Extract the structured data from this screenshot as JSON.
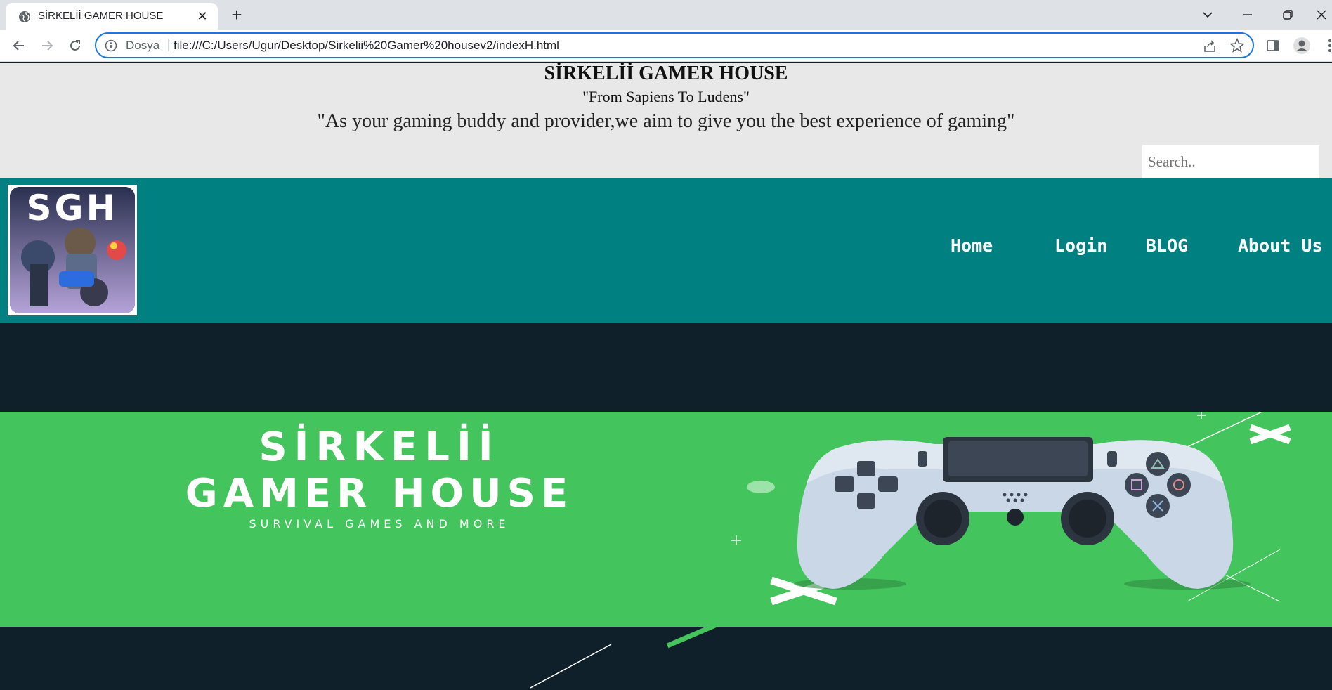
{
  "browser": {
    "tab_title": "SİRKELİİ GAMER HOUSE",
    "new_tab": "+",
    "close_tab": "✕",
    "scheme_label": "Dosya",
    "url": "file:///C:/Users/Ugur/Desktop/Sirkelii%20Gamer%20housev2/indexH.html",
    "accent": "#1a73e8"
  },
  "header": {
    "title": "SİRKELİİ GAMER HOUSE",
    "motto": "\"From Sapiens To Ludens\"",
    "mission": "\"As your gaming buddy and provider,we aim to give you the best experience of gaming\"",
    "search_placeholder": "Search.."
  },
  "navbar": {
    "logo_text": "SGH",
    "background": "#008080",
    "links": [
      {
        "label": "Home"
      },
      {
        "label": "Login"
      },
      {
        "label": "BLOG"
      },
      {
        "label": "About Us"
      }
    ]
  },
  "hero": {
    "line1": "SİRKELİİ",
    "line2": "GAMER HOUSE",
    "tagline": "SURVIVAL GAMES AND MORE",
    "banner_color": "#44c45c",
    "dark_color": "#10202a",
    "image": "gamepad-controller-icon"
  }
}
